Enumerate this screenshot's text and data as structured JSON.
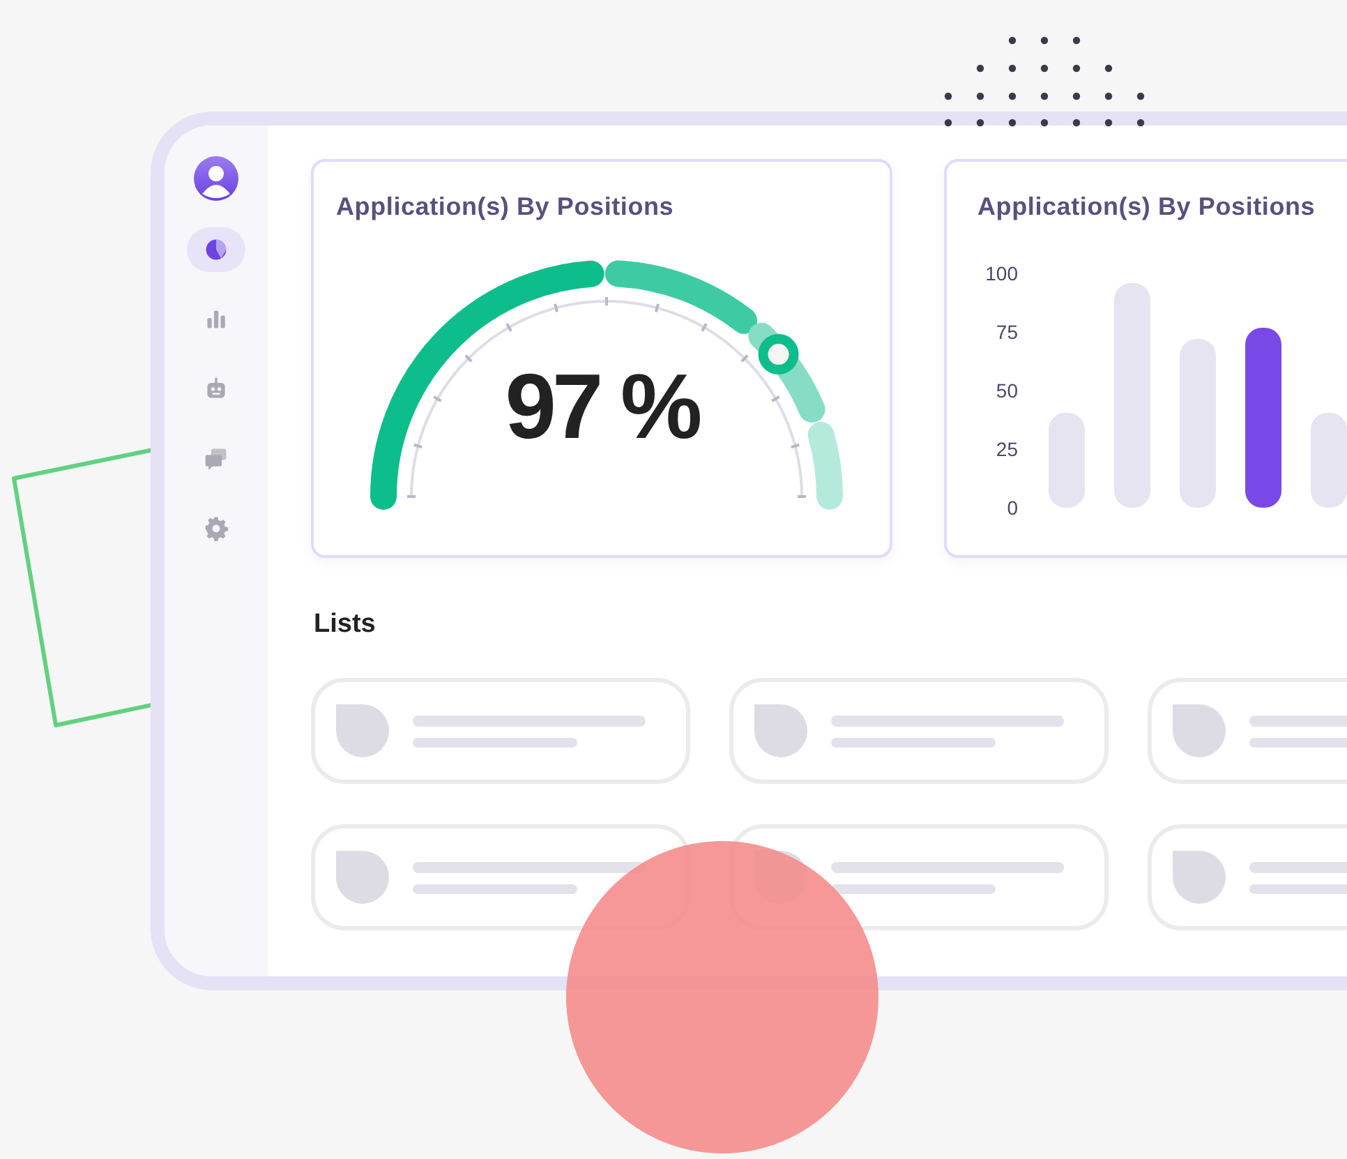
{
  "sidebar": {
    "items": [
      {
        "selected": true
      },
      {
        "selected": false
      },
      {
        "selected": false
      },
      {
        "selected": false
      },
      {
        "selected": false
      }
    ]
  },
  "gauge_card": {
    "title": "Application(s) By Positions",
    "value": "97 %",
    "level": 0.78
  },
  "bar_card": {
    "title": "Application(s) By Positions",
    "axis_labels": [
      "100",
      "75",
      "50",
      "25",
      "0"
    ],
    "bars": [
      {
        "selected": false
      },
      {
        "selected": false
      },
      {
        "selected": false
      },
      {
        "selected": true
      },
      {
        "selected": false
      }
    ]
  },
  "lists": {
    "title": "Lists",
    "cards": [
      {
        "kind": "skeleton"
      },
      {
        "kind": "skeleton"
      },
      {
        "kind": "skeleton"
      },
      {
        "kind": "skeleton"
      },
      {
        "kind": "skeleton"
      },
      {
        "kind": "skeleton"
      }
    ]
  }
}
